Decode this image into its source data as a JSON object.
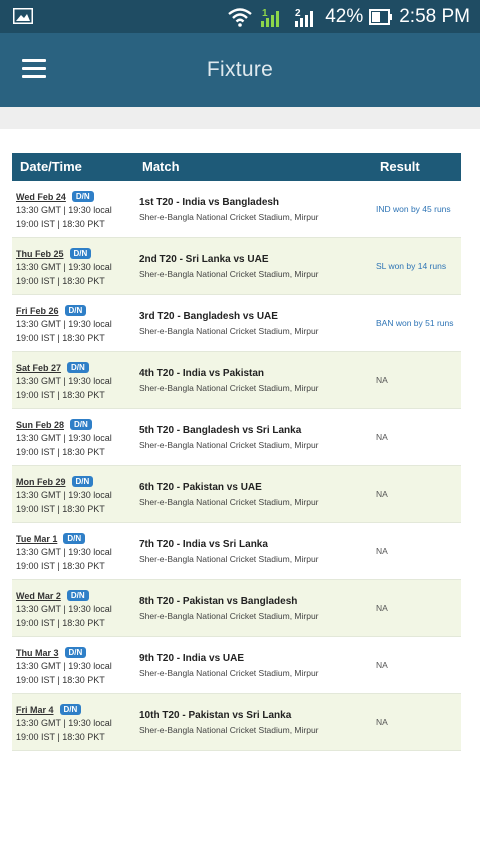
{
  "status_bar": {
    "battery": "42%",
    "time": "2:58 PM",
    "sim1": "1",
    "sim2": "2",
    "icons": [
      "gallery-icon",
      "wifi-icon",
      "signal-icon",
      "battery-icon"
    ]
  },
  "app_bar": {
    "title": "Fixture",
    "menu_icon": "menu-icon"
  },
  "table": {
    "headers": {
      "date": "Date/Time",
      "match": "Match",
      "result": "Result"
    },
    "rows": [
      {
        "date": "Wed Feb 24",
        "badge": "D/N",
        "time1": "13:30 GMT | 19:30 local",
        "time2": "19:00 IST | 18:30 PKT",
        "match": "1st T20 - India vs Bangladesh",
        "venue": "Sher-e-Bangla National Cricket Stadium, Mirpur",
        "result": "IND won by 45 runs"
      },
      {
        "date": "Thu Feb 25",
        "badge": "D/N",
        "time1": "13:30 GMT | 19:30 local",
        "time2": "19:00 IST | 18:30 PKT",
        "match": "2nd T20 - Sri Lanka vs UAE",
        "venue": "Sher-e-Bangla National Cricket Stadium, Mirpur",
        "result": "SL won by 14 runs"
      },
      {
        "date": "Fri Feb 26",
        "badge": "D/N",
        "time1": "13:30 GMT | 19:30 local",
        "time2": "19:00 IST | 18:30 PKT",
        "match": "3rd T20 - Bangladesh vs UAE",
        "venue": "Sher-e-Bangla National Cricket Stadium, Mirpur",
        "result": "BAN won by 51 runs"
      },
      {
        "date": "Sat Feb 27",
        "badge": "D/N",
        "time1": "13:30 GMT | 19:30 local",
        "time2": "19:00 IST | 18:30 PKT",
        "match": "4th T20 - India vs Pakistan",
        "venue": "Sher-e-Bangla National Cricket Stadium, Mirpur",
        "result": "NA"
      },
      {
        "date": "Sun Feb 28",
        "badge": "D/N",
        "time1": "13:30 GMT | 19:30 local",
        "time2": "19:00 IST | 18:30 PKT",
        "match": "5th T20 - Bangladesh vs Sri Lanka",
        "venue": "Sher-e-Bangla National Cricket Stadium, Mirpur",
        "result": "NA"
      },
      {
        "date": "Mon Feb 29",
        "badge": "D/N",
        "time1": "13:30 GMT | 19:30 local",
        "time2": "19:00 IST | 18:30 PKT",
        "match": "6th T20 - Pakistan vs UAE",
        "venue": "Sher-e-Bangla National Cricket Stadium, Mirpur",
        "result": "NA"
      },
      {
        "date": "Tue Mar 1",
        "badge": "D/N",
        "time1": "13:30 GMT | 19:30 local",
        "time2": "19:00 IST | 18:30 PKT",
        "match": "7th T20 - India vs Sri Lanka",
        "venue": "Sher-e-Bangla National Cricket Stadium, Mirpur",
        "result": "NA"
      },
      {
        "date": "Wed Mar 2",
        "badge": "D/N",
        "time1": "13:30 GMT | 19:30 local",
        "time2": "19:00 IST | 18:30 PKT",
        "match": "8th T20 - Pakistan vs Bangladesh",
        "venue": "Sher-e-Bangla National Cricket Stadium, Mirpur",
        "result": "NA"
      },
      {
        "date": "Thu Mar 3",
        "badge": "D/N",
        "time1": "13:30 GMT | 19:30 local",
        "time2": "19:00 IST | 18:30 PKT",
        "match": "9th T20 - India vs UAE",
        "venue": "Sher-e-Bangla National Cricket Stadium, Mirpur",
        "result": "NA"
      },
      {
        "date": "Fri Mar 4",
        "badge": "D/N",
        "time1": "13:30 GMT | 19:30 local",
        "time2": "19:00 IST | 18:30 PKT",
        "match": "10th T20 - Pakistan vs Sri Lanka",
        "venue": "Sher-e-Bangla National Cricket Stadium, Mirpur",
        "result": "NA"
      }
    ]
  },
  "colors": {
    "status_bar": "#1f4c63",
    "app_bar": "#2a6280",
    "table_header": "#1e5a78",
    "alt_row": "#f2f6e5",
    "badge": "#2f7fc7",
    "result_link": "#2e74b5"
  }
}
